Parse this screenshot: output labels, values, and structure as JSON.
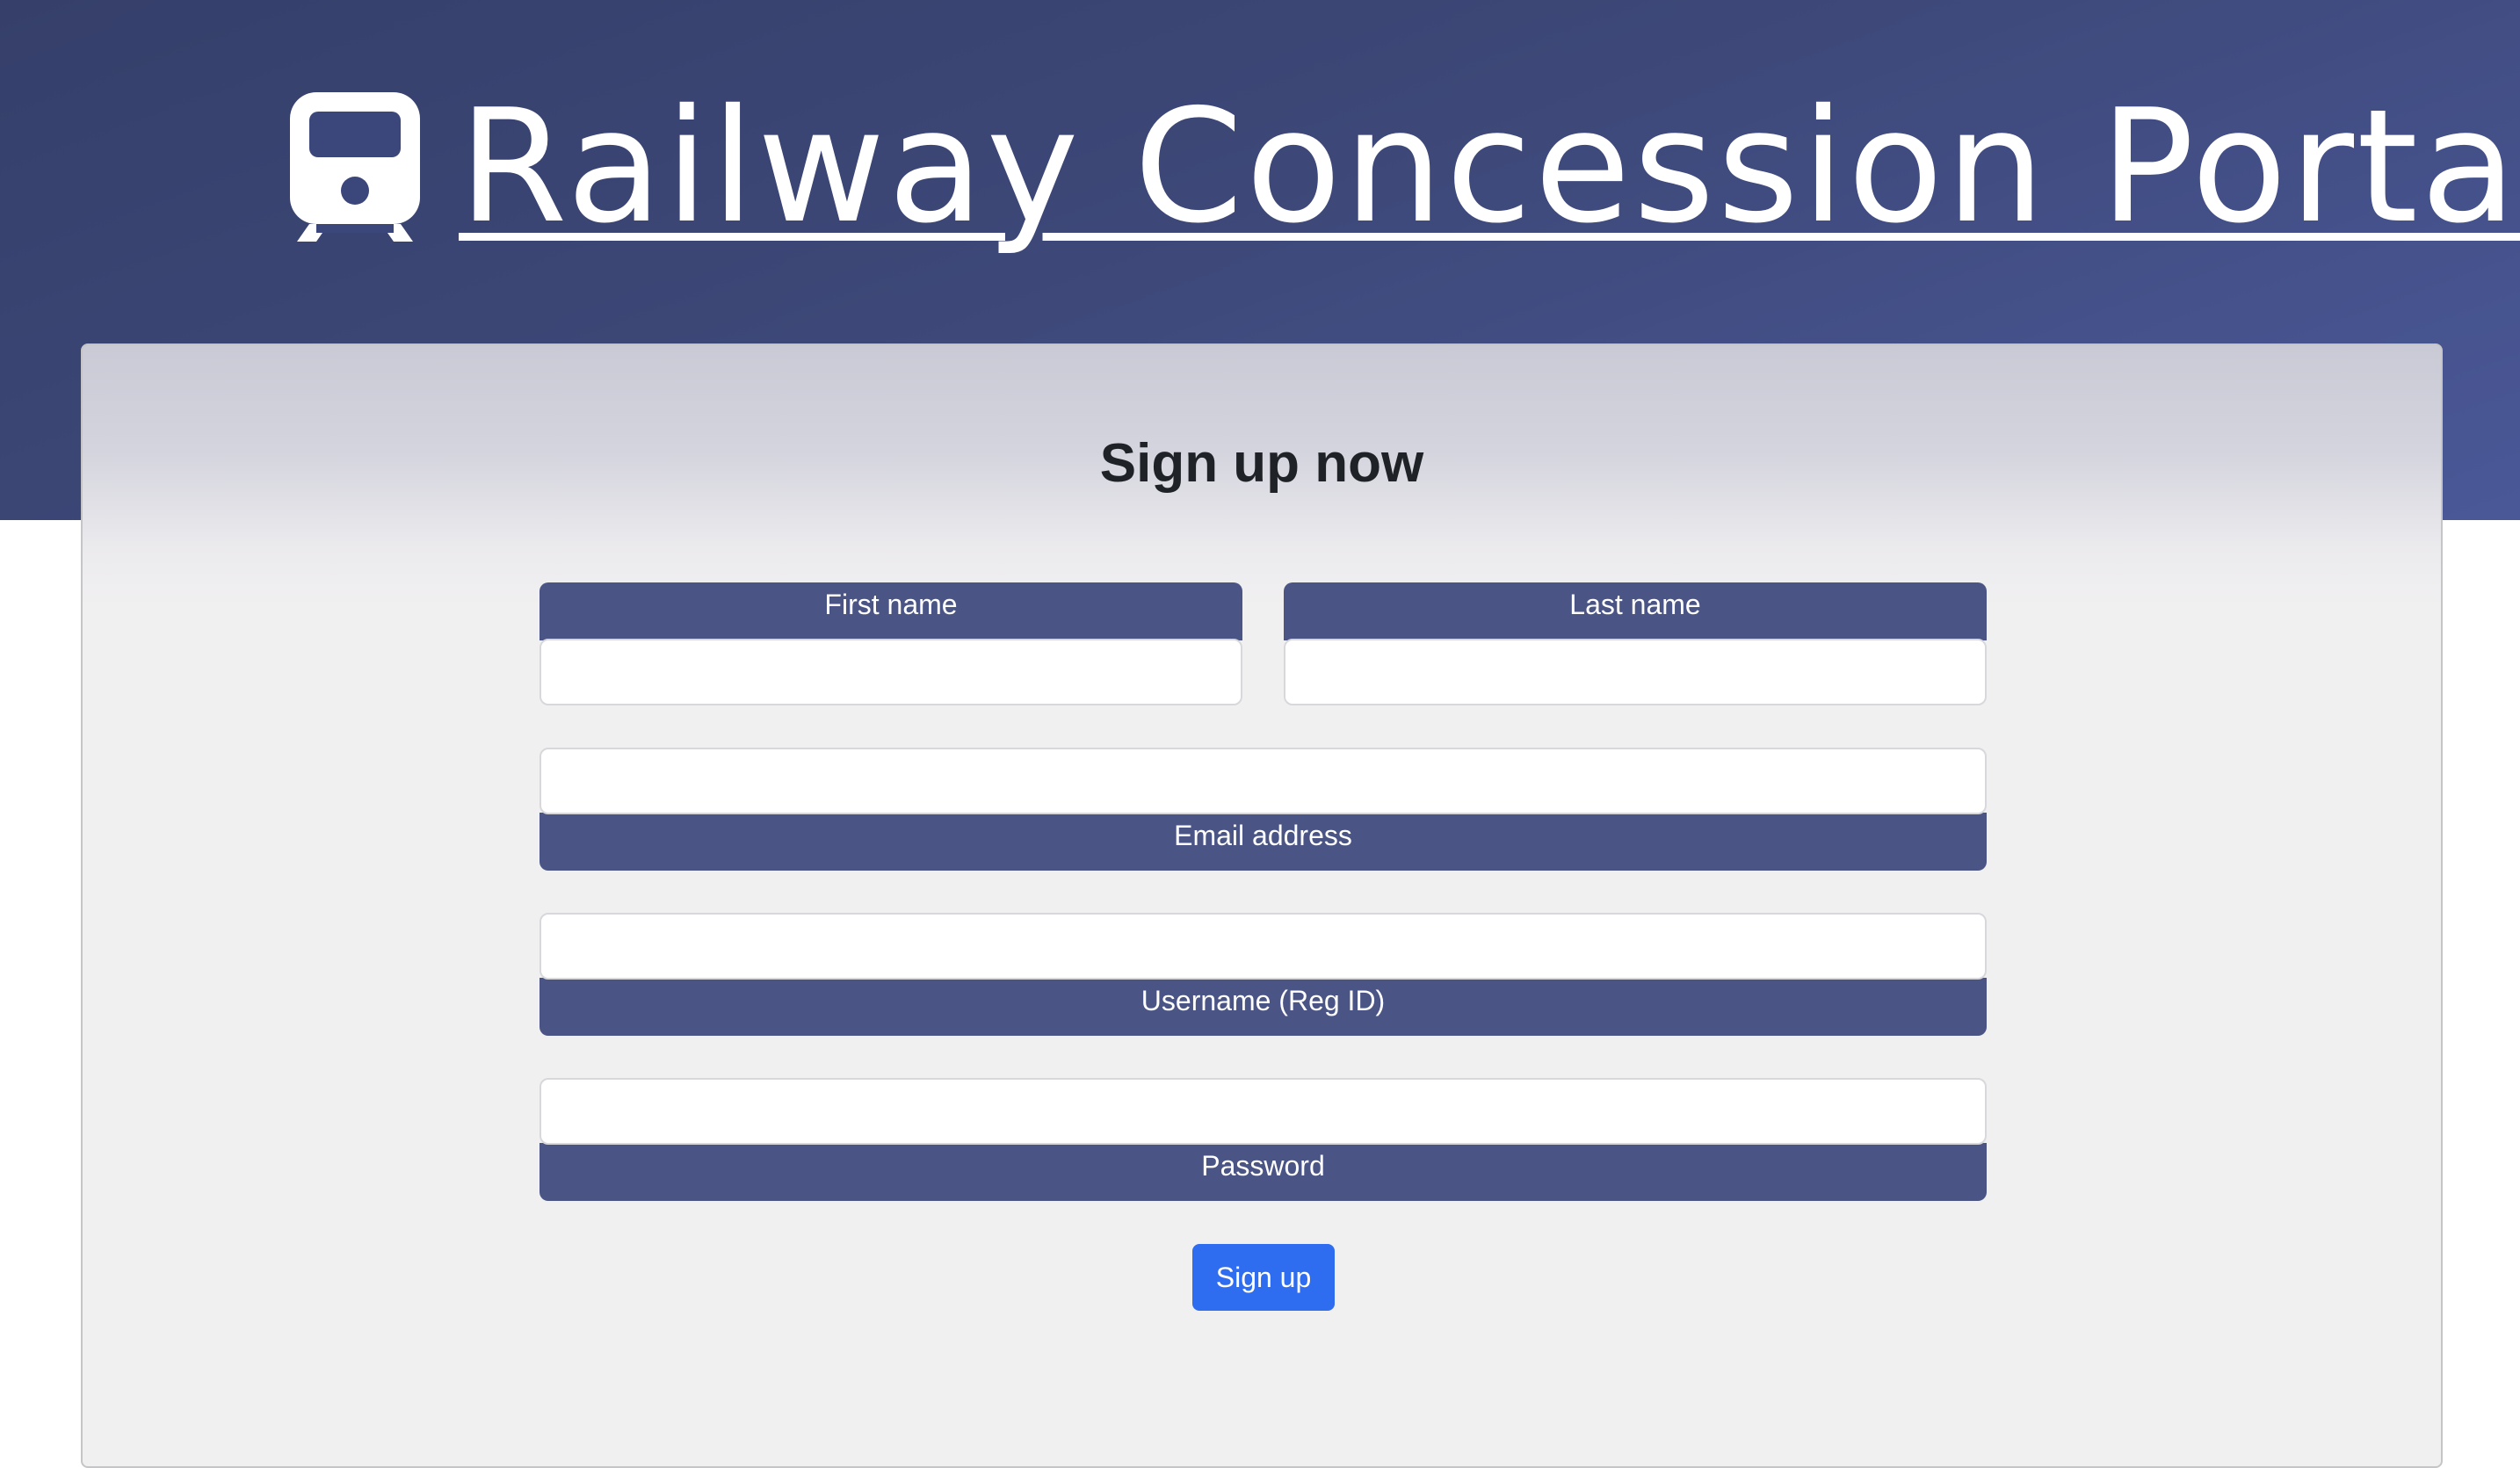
{
  "header": {
    "title": "Railway Concession Portal",
    "icon": "train-icon"
  },
  "signup": {
    "heading": "Sign up now",
    "fields": {
      "first_name": {
        "label": "First name",
        "value": ""
      },
      "last_name": {
        "label": "Last name",
        "value": ""
      },
      "email": {
        "label": "Email address",
        "value": ""
      },
      "username": {
        "label": "Username (Reg ID)",
        "value": ""
      },
      "password": {
        "label": "Password",
        "value": ""
      }
    },
    "submit_label": "Sign up"
  },
  "colors": {
    "hero_dark": "#353f6a",
    "hero_light": "#4a5898",
    "label_bg": "#4a5585",
    "button": "#2e6cf0"
  }
}
